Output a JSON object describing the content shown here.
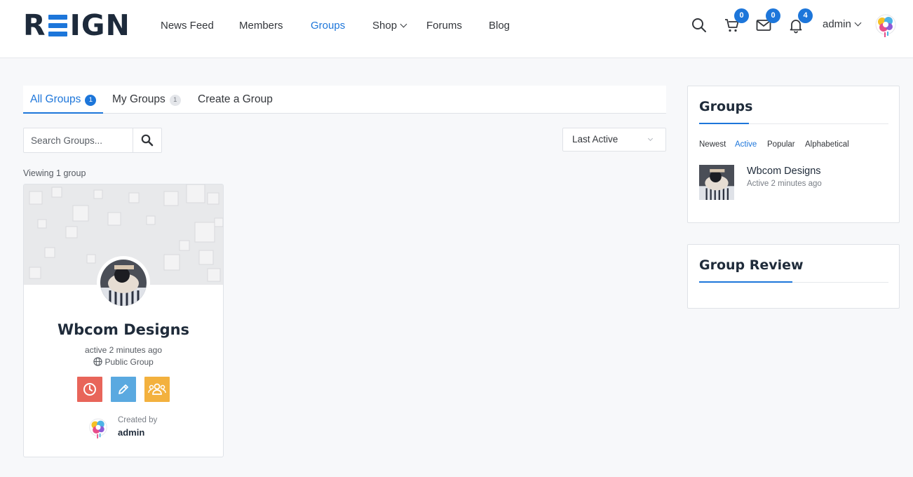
{
  "brand": {
    "logo_left": "R",
    "logo_right": "IGN",
    "accent": "#1d76da"
  },
  "nav": [
    {
      "label": "News Feed",
      "active": false
    },
    {
      "label": "Members",
      "active": false
    },
    {
      "label": "Groups",
      "active": true
    },
    {
      "label": "Shop",
      "active": false,
      "dropdown": true
    },
    {
      "label": "Forums",
      "active": false
    },
    {
      "label": "Blog",
      "active": false
    }
  ],
  "header": {
    "icons": [
      "search-icon",
      "cart-icon",
      "mail-icon",
      "bell-icon"
    ],
    "cart_count": "0",
    "messages_count": "0",
    "notifications_count": "4",
    "user_name": "admin"
  },
  "tabs": [
    {
      "label": "All Groups",
      "count": "1",
      "active": true
    },
    {
      "label": "My Groups",
      "count": "1",
      "active": false
    },
    {
      "label": "Create a Group",
      "active": false
    }
  ],
  "search": {
    "placeholder": "Search Groups..."
  },
  "sort": {
    "selected": "Last Active"
  },
  "viewing_text": "Viewing 1 group",
  "group_card": {
    "name": "Wbcom Designs",
    "active": "active 2 minutes ago",
    "type": "Public Group",
    "action_colors": [
      "#e8655a",
      "#5aa9e0",
      "#f3b13e"
    ],
    "created_by_label": "Created by",
    "creator": "admin"
  },
  "widget_groups": {
    "title": "Groups",
    "filters": [
      {
        "label": "Newest",
        "active": false
      },
      {
        "label": "Active",
        "active": true
      },
      {
        "label": "Popular",
        "active": false
      },
      {
        "label": "Alphabetical",
        "active": false
      }
    ],
    "item": {
      "name": "Wbcom Designs",
      "meta": "Active 2 minutes ago"
    }
  },
  "widget_review": {
    "title": "Group Review"
  }
}
